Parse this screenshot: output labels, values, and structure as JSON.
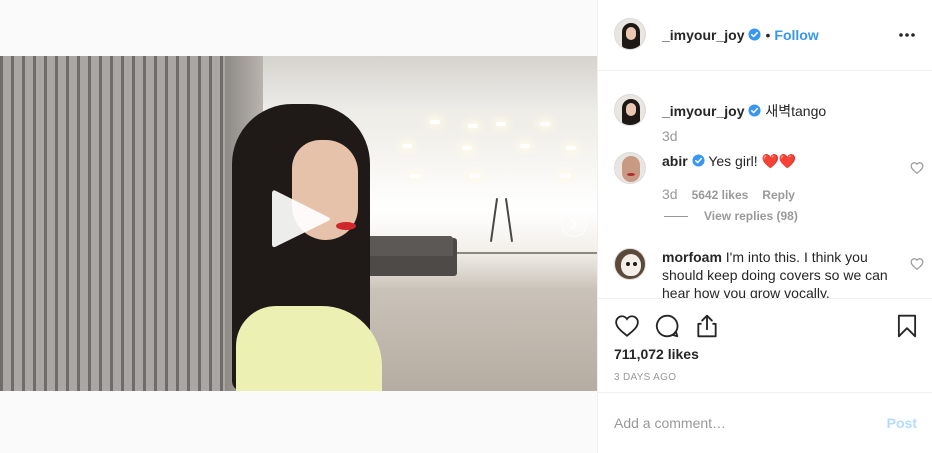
{
  "post": {
    "username": "_imyour_joy",
    "verified": true,
    "follow_label": "Follow",
    "separator": "•",
    "more_icon": "more-horizontal-icon"
  },
  "caption": {
    "username": "_imyour_joy",
    "text": "새벽tango",
    "time": "3d"
  },
  "comments": [
    {
      "username": "abir",
      "verified": true,
      "text": "Yes girl! ❤️❤️",
      "time": "3d",
      "likes": "5642 likes",
      "reply_label": "Reply",
      "view_replies": "View replies (98)"
    },
    {
      "username": "morfoam",
      "verified": false,
      "text": "I'm into this. I think you should keep doing covers so we can hear how you grow vocally."
    }
  ],
  "actions": {
    "like_icon": "heart-icon",
    "comment_icon": "comment-icon",
    "share_icon": "share-icon",
    "save_icon": "bookmark-icon"
  },
  "likes": "711,072 likes",
  "time_ago": "3 DAYS AGO",
  "add_comment": {
    "placeholder": "Add a comment…",
    "post_label": "Post"
  },
  "colors": {
    "accent": "#3897f0",
    "post_disabled": "#b3dbff",
    "verified": "#3897f0"
  }
}
